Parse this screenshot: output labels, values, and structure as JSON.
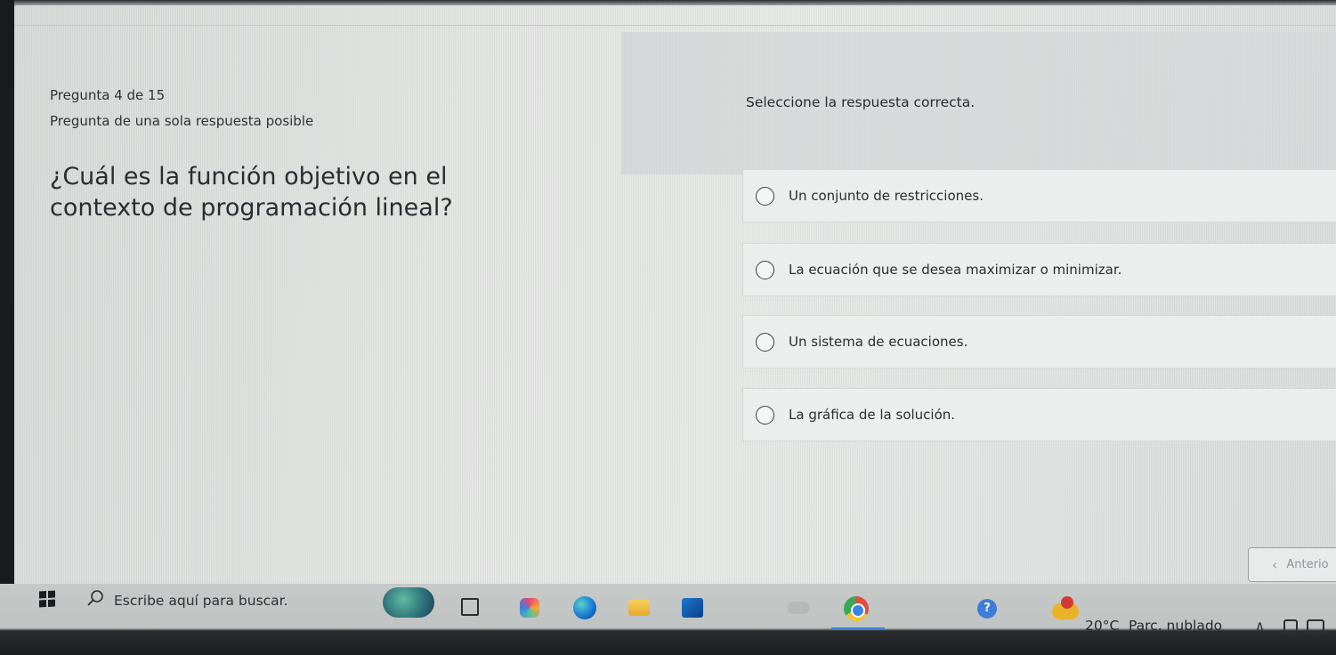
{
  "quiz": {
    "question_number": "Pregunta 4 de 15",
    "question_type": "Pregunta de una sola respuesta posible",
    "question_text": "¿Cuál es la función objetivo en el contexto de programación lineal?",
    "instruction": "Seleccione la respuesta correcta.",
    "options": [
      {
        "label": "Un conjunto de restricciones.",
        "selected": false
      },
      {
        "label": "La ecuación que se desea maximizar o minimizar.",
        "selected": false
      },
      {
        "label": "Un sistema de ecuaciones.",
        "selected": false
      },
      {
        "label": "La gráfica de la solución.",
        "selected": false
      }
    ],
    "prev_button": "Anterio"
  },
  "taskbar": {
    "search_placeholder": "Escribe aquí para buscar.",
    "temperature": "20°C",
    "weather": "Parc. nublado",
    "help_glyph": "?"
  },
  "colors": {
    "active_indicator": "#3f7fd9",
    "page_background": "#e4e6e4"
  }
}
